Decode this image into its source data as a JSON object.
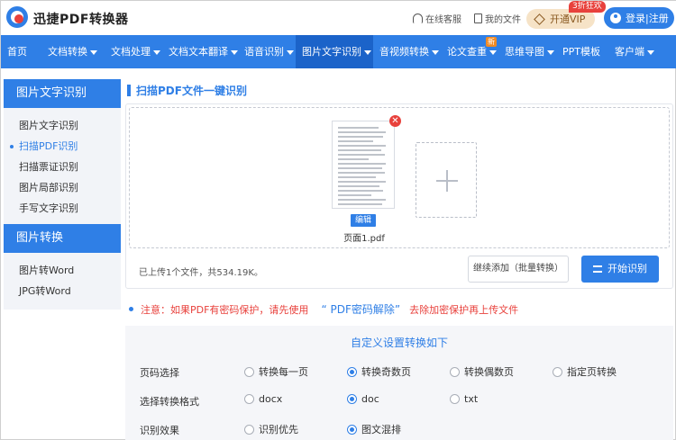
{
  "header": {
    "logo_text": "迅捷PDF转换器",
    "online_service": "在线客服",
    "my_files": "我的文件",
    "vip_label": "开通VIP",
    "vip_badge": "3折狂欢",
    "login_label": "登录|注册"
  },
  "nav": {
    "items": [
      {
        "label": "首页"
      },
      {
        "label": "文档转换"
      },
      {
        "label": "文档处理"
      },
      {
        "label": "文档文本翻译"
      },
      {
        "label": "语音识别"
      },
      {
        "label": "图片文字识别"
      },
      {
        "label": "音视频转换"
      },
      {
        "label": "论文查重"
      },
      {
        "label": "思维导图"
      },
      {
        "label": "PPT模板"
      },
      {
        "label": "客户端"
      }
    ],
    "new_badge": "新"
  },
  "sidebar": {
    "section1_title": "图片文字识别",
    "section1_items": [
      "图片文字识别",
      "扫描PDF识别",
      "扫描票证识别",
      "图片局部识别",
      "手写文字识别"
    ],
    "section2_title": "图片转换",
    "section2_items": [
      "图片转Word",
      "JPG转Word"
    ]
  },
  "main": {
    "title": "扫描PDF文件一键识别",
    "file": {
      "edit_label": "编辑",
      "name": "页面1.pdf",
      "remove_symbol": "✕"
    },
    "upload_info": "已上传1个文件，共534.19K。",
    "continue_label": "继续添加（批量转换）",
    "start_label": "开始识别"
  },
  "notice": {
    "prefix": "注意：如果PDF有密码保护，请先使用",
    "link": "“ PDF密码解除”",
    "suffix": "去除加密保护再上传文件"
  },
  "settings": {
    "title": "自定义设置转换如下",
    "page_label": "页码选择",
    "page_options": [
      "转换每一页",
      "转换奇数页",
      "转换偶数页",
      "指定页转换"
    ],
    "page_selected": 1,
    "format_label": "选择转换格式",
    "format_options": [
      "docx",
      "doc",
      "txt"
    ],
    "format_selected": 1,
    "effect_label": "识别效果",
    "effect_options": [
      "识别优先",
      "图文混排"
    ],
    "effect_selected": 1
  },
  "colors": {
    "primary": "#2f7fe6",
    "nav_active": "#1b63c9",
    "danger": "#e8413c"
  }
}
